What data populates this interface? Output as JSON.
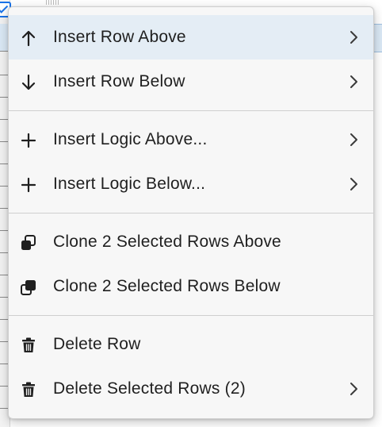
{
  "menu": {
    "items": [
      {
        "label": "Insert Row Above",
        "icon": "arrow-up-icon",
        "submenu": true,
        "active": true
      },
      {
        "label": "Insert Row Below",
        "icon": "arrow-down-icon",
        "submenu": true,
        "active": false
      },
      {
        "label": "Insert Logic Above...",
        "icon": "plus-icon",
        "submenu": true,
        "active": false
      },
      {
        "label": "Insert Logic Below...",
        "icon": "plus-icon",
        "submenu": true,
        "active": false
      },
      {
        "label": "Clone 2 Selected Rows Above",
        "icon": "clone-above-icon",
        "submenu": false,
        "active": false
      },
      {
        "label": "Clone 2 Selected Rows Below",
        "icon": "clone-below-icon",
        "submenu": false,
        "active": false
      },
      {
        "label": "Delete Row",
        "icon": "trash-icon",
        "submenu": false,
        "active": false
      },
      {
        "label": "Delete Selected Rows (2)",
        "icon": "trash-icon",
        "submenu": true,
        "active": false
      }
    ]
  },
  "colors": {
    "highlight": "#e4edf5",
    "menu_background": "#f7f7f7",
    "text": "#1f1f1f",
    "separator": "#cfcfcf",
    "checkbox_accent": "#1a73e8"
  }
}
